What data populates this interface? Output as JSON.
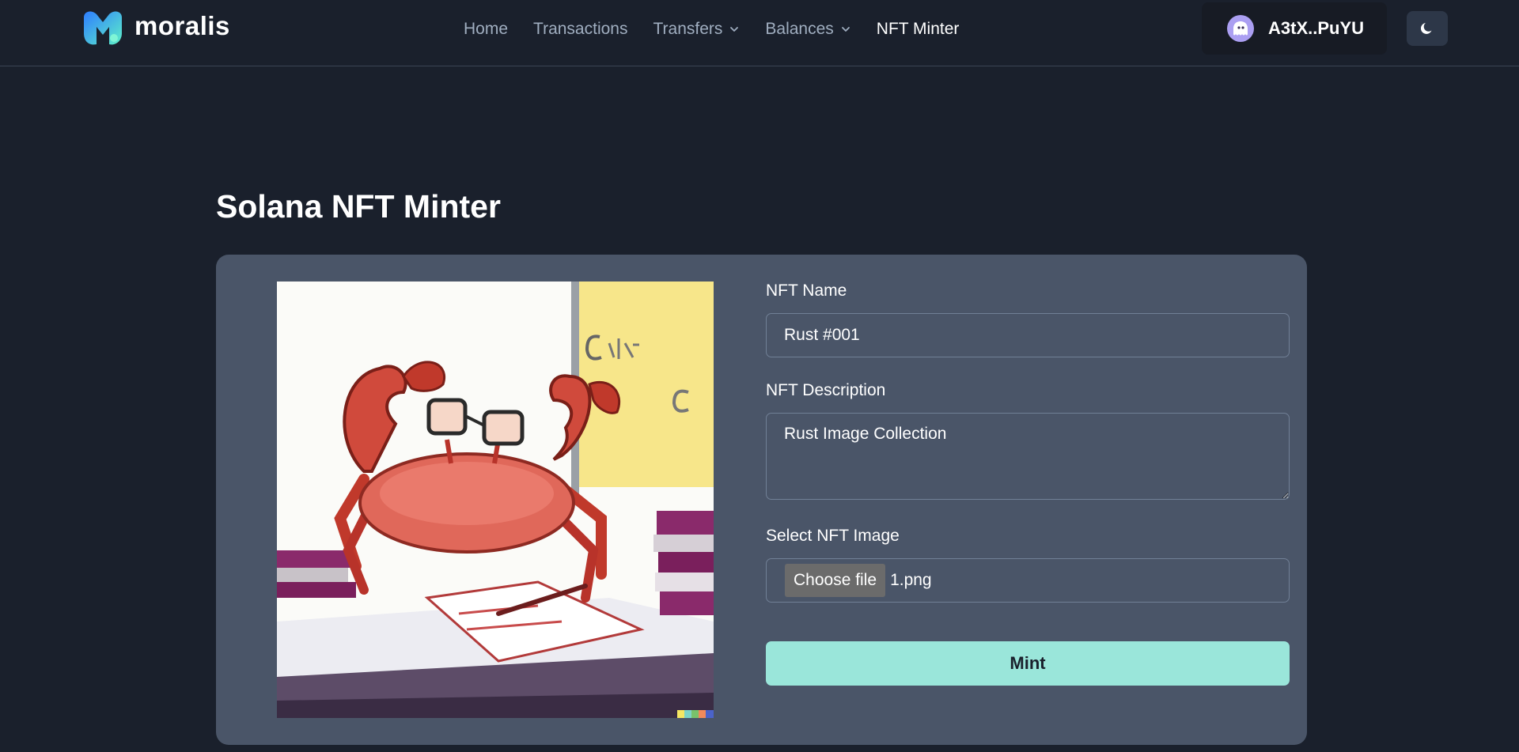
{
  "brand": {
    "name": "moralis"
  },
  "nav": {
    "items": [
      {
        "label": "Home",
        "dropdown": false,
        "active": false
      },
      {
        "label": "Transactions",
        "dropdown": false,
        "active": false
      },
      {
        "label": "Transfers",
        "dropdown": true,
        "active": false
      },
      {
        "label": "Balances",
        "dropdown": true,
        "active": false
      },
      {
        "label": "NFT Minter",
        "dropdown": false,
        "active": true
      }
    ]
  },
  "wallet": {
    "address": "A3tX..PuYU",
    "icon": "phantom-ghost-icon"
  },
  "theme_toggle": {
    "icon": "moon-icon"
  },
  "page": {
    "title": "Solana NFT Minter"
  },
  "form": {
    "name_label": "NFT Name",
    "name_value": "Rust #001",
    "description_label": "NFT Description",
    "description_value": "Rust Image Collection",
    "image_label": "Select NFT Image",
    "file_button_label": "Choose file",
    "file_name": "1.png",
    "mint_label": "Mint"
  },
  "colors": {
    "background": "#1a202c",
    "card": "#4a5568",
    "accent": "#9ae6da",
    "wallet_icon": "#ab9ff2"
  }
}
